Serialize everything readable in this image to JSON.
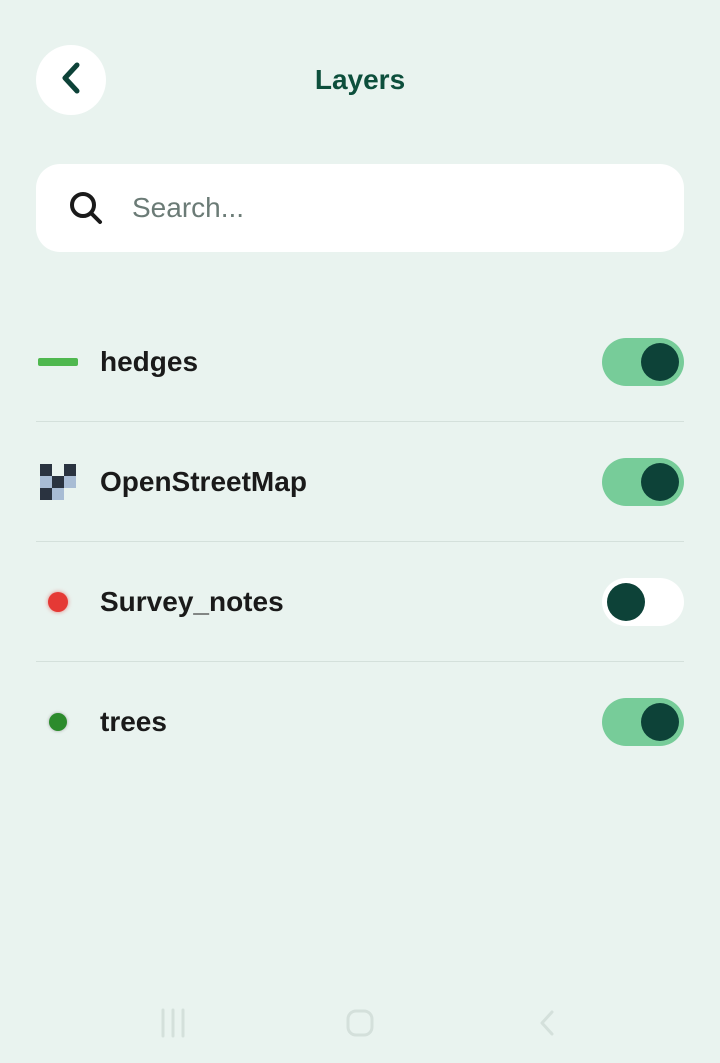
{
  "header": {
    "title": "Layers"
  },
  "search": {
    "placeholder": "Search..."
  },
  "layers": [
    {
      "name": "hedges",
      "icon": "hedges",
      "enabled": true
    },
    {
      "name": "OpenStreetMap",
      "icon": "osm",
      "enabled": true
    },
    {
      "name": "Survey_notes",
      "icon": "survey",
      "enabled": false
    },
    {
      "name": "trees",
      "icon": "trees",
      "enabled": true
    }
  ]
}
